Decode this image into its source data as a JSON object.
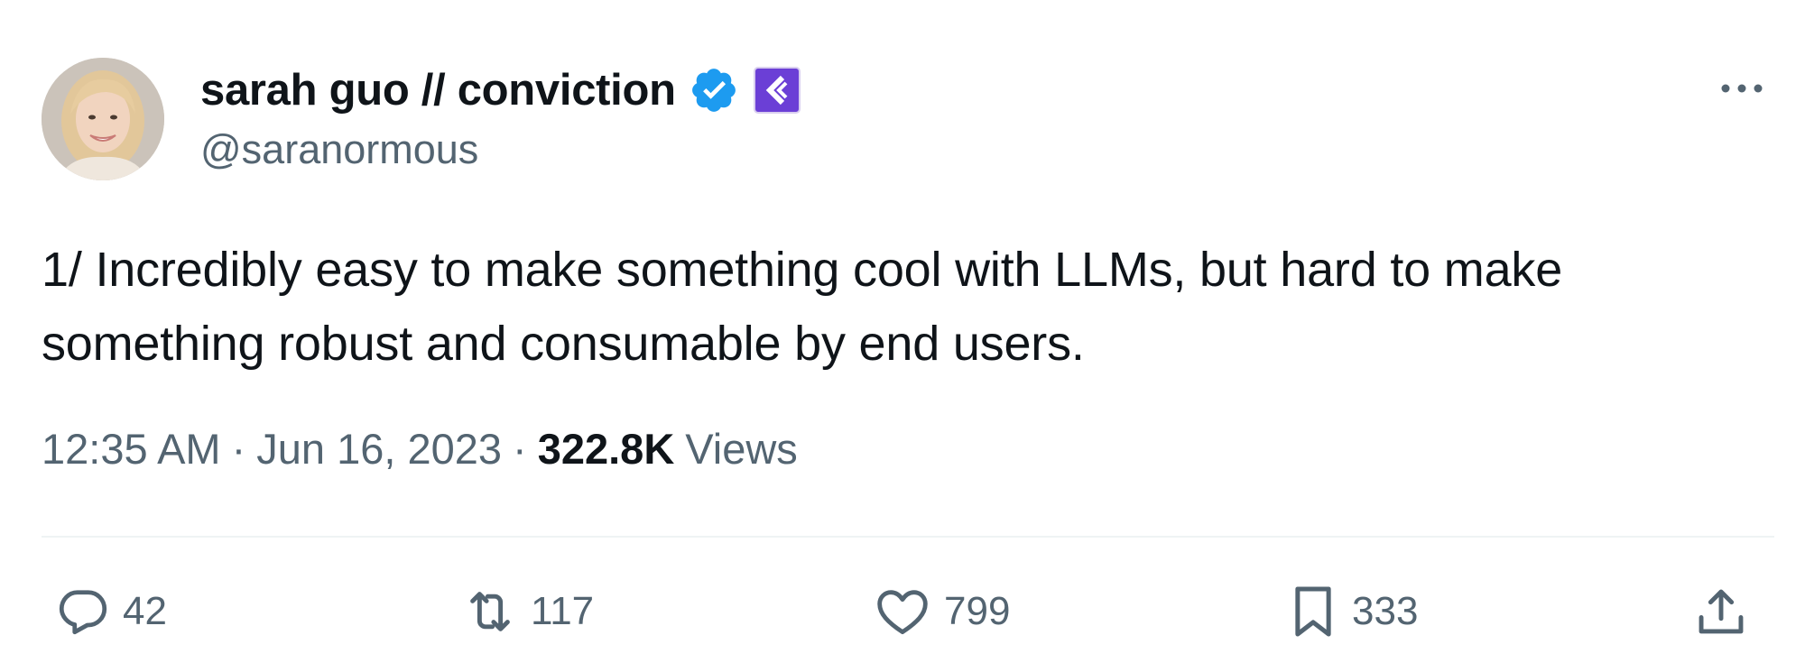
{
  "author": {
    "display_name": "sarah guo // conviction",
    "handle": "@saranormous",
    "verified": true,
    "affiliate_badge": "conviction-logo"
  },
  "tweet": {
    "text": "1/ Incredibly easy to make something cool with LLMs, but hard to make something robust and consumable by end users."
  },
  "meta": {
    "time": "12:35 AM",
    "separator": "·",
    "date": "Jun 16, 2023",
    "views_count": "322.8K",
    "views_label": "Views"
  },
  "actions": {
    "replies": "42",
    "retweets": "117",
    "likes": "799",
    "bookmarks": "333"
  },
  "colors": {
    "text_primary": "#0f1419",
    "text_secondary": "#536471",
    "verified_blue": "#1d9bf0",
    "affiliate_purple": "#6b3fd6",
    "divider": "#eff3f4"
  },
  "icons": {
    "more": "more-horizontal-icon",
    "reply": "reply-icon",
    "retweet": "retweet-icon",
    "like": "heart-icon",
    "bookmark": "bookmark-icon",
    "share": "share-icon"
  }
}
